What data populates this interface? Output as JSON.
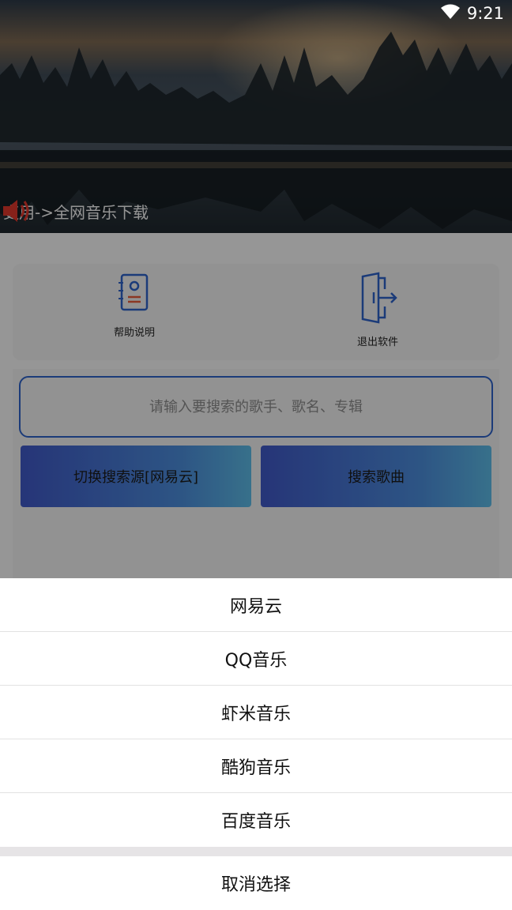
{
  "status_bar": {
    "time": "9:21"
  },
  "banner": {
    "marquee_text": "吏用->全网音乐下载"
  },
  "actions": {
    "help_label": "帮助说明",
    "exit_label": "退出软件"
  },
  "search": {
    "placeholder": "请输入要搜索的歌手、歌名、专辑",
    "source_button": "切换搜索源[网易云]",
    "search_button": "搜索歌曲"
  },
  "sheet": {
    "options": [
      "网易云",
      "QQ音乐",
      "虾米音乐",
      "酷狗音乐",
      "百度音乐"
    ],
    "cancel": "取消选择"
  },
  "colors": {
    "accent_blue": "#2d5fc4",
    "button_gradient_start": "#3e56c2",
    "button_gradient_end": "#5ab6e0",
    "speaker_red": "#d9362b"
  }
}
